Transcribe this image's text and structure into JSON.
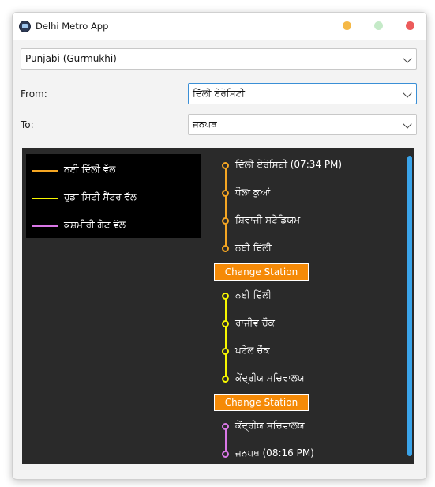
{
  "window": {
    "title": "Delhi Metro App"
  },
  "language": {
    "selected": "Punjabi (Gurmukhi)"
  },
  "from": {
    "label": "From:",
    "value": "ਦਿੱਲੀ ਏਰੋਸਿਟੀ"
  },
  "to": {
    "label": "To:",
    "value": "ਜਨਪਥ"
  },
  "legend": [
    {
      "label": "ਨਈ ਦਿੱਲੀ ਵੱਲ",
      "color": "#f5a623"
    },
    {
      "label": "ਹੁਡਾ ਸਿਟੀ ਸੈਂਟਰ ਵੱਲ",
      "color": "#f7f700"
    },
    {
      "label": "ਕਸ਼ਮੀਰੀ ਗੇਟ ਵੱਲ",
      "color": "#d977e6"
    }
  ],
  "route": {
    "segment1": {
      "color": "#f5a623",
      "stops": [
        "ਦਿੱਲੀ ਏਰੋਸਿਟੀ (07:34 PM)",
        "ਧੌਲਾ ਕੁਆਂ",
        "ਸ਼ਿਵਾਜੀ ਸਟੇਡਿਯਮ",
        "ਨਈ ਦਿੱਲੀ"
      ]
    },
    "change1": "Change Station",
    "segment2": {
      "color": "#f7f700",
      "stops": [
        "ਨਈ ਦਿੱਲੀ",
        "ਰਾਜੀਵ ਚੌਕ",
        "ਪਟੇਲ ਚੌਕ",
        "ਕੇਂਦ੍ਰੀਯ ਸਚਿਵਾਲਯ"
      ]
    },
    "change2": "Change Station",
    "segment3": {
      "color": "#d977e6",
      "stops": [
        "ਕੇਂਦ੍ਰੀਯ ਸਚਿਵਾਲਯ",
        "ਜਨਪਥ (08:16 PM)"
      ]
    }
  },
  "colors": {
    "accent": "#3aa4ea",
    "change_button": "#f58a07"
  }
}
